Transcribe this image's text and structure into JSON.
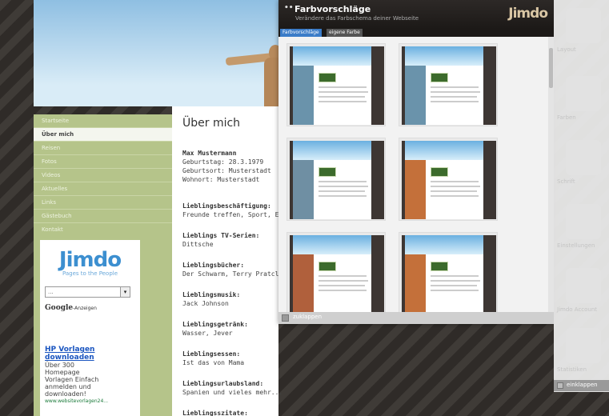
{
  "nav": {
    "items": [
      "Startseite",
      "Über mich",
      "Reisen",
      "Fotos",
      "Videos",
      "Aktuelles",
      "Links",
      "Gästebuch",
      "Kontakt"
    ],
    "active_index": 1
  },
  "sidebar": {
    "logo": "Jimdo",
    "tagline": "Pages to the People",
    "select_value": "...",
    "google": "Google",
    "google_suffix": "-Anzeigen",
    "ad_title": "HP Vorlagen downloaden",
    "ad_lines": [
      "Über 300",
      "Homepage",
      "Vorlagen Einfach",
      "anmelden und",
      "downloaden!"
    ],
    "ad_url": "www.websitevorlagen24..."
  },
  "content": {
    "title": "Über mich",
    "blocks": [
      {
        "heading": "Max Mustermann",
        "lines": [
          "Geburtstag: 28.3.1979",
          "Geburtsort: Musterstadt",
          "Wohnort: Musterstadt"
        ]
      },
      {
        "heading": "Lieblingsbeschäftigung:",
        "lines": [
          "Freunde treffen, Sport, Es"
        ]
      },
      {
        "heading": "Lieblings TV-Serien:",
        "lines": [
          "Dittsche"
        ]
      },
      {
        "heading": "Lieblingsbücher:",
        "lines": [
          "Der Schwarm, Terry Pratcl"
        ]
      },
      {
        "heading": "Lieblingsmusik:",
        "lines": [
          "Jack Johnson"
        ]
      },
      {
        "heading": "Lieblingsgetränk:",
        "lines": [
          "Wasser, Jever"
        ]
      },
      {
        "heading": "Lieblingsessen:",
        "lines": [
          "Ist das von Mama"
        ]
      },
      {
        "heading": "Lieblingsurlaubsland:",
        "lines": [
          "Spanien und vieles mehr..."
        ]
      },
      {
        "heading": "Lieblingsszitate:",
        "lines": []
      }
    ]
  },
  "panel": {
    "title": "Farbvorschläge",
    "subtitle": "Verändere das Farbschema deiner Webseite",
    "logo": "Jimdo",
    "tabs": [
      "Farbvorschläge",
      "eigene Farbe"
    ],
    "collapse_label": "zuklappen",
    "themes": [
      {
        "accent": "#6a93ab"
      },
      {
        "accent": "#6a93ab"
      },
      {
        "accent": "#6f8fa3"
      },
      {
        "accent": "#c4703a"
      },
      {
        "accent": "#b0603c"
      },
      {
        "accent": "#c4703a"
      }
    ]
  },
  "toolbar": {
    "items": [
      "Layout",
      "Farben",
      "Schrift",
      "Einstellungen",
      "Jimdo Account",
      "Statistiken"
    ],
    "collapse_label": "einklappen"
  }
}
